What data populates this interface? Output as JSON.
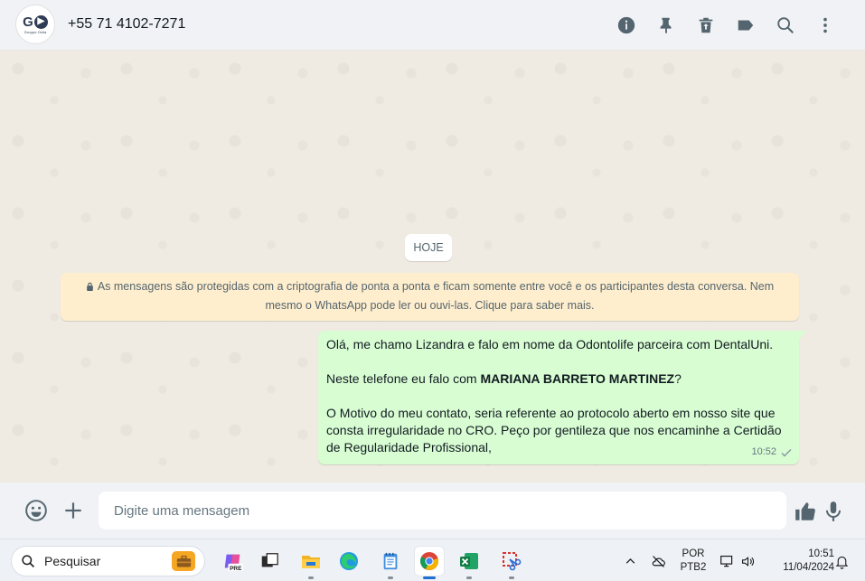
{
  "header": {
    "avatar_logo_text": "G",
    "avatar_brand": "Gruppo Ocila",
    "contact": "+55 71 4102-7271",
    "icons": [
      "info-icon",
      "pin-icon",
      "delete-icon",
      "label-icon",
      "search-icon",
      "menu-icon"
    ]
  },
  "chat": {
    "day_label": "HOJE",
    "encryption_notice": "As mensagens são protegidas com a criptografia de ponta a ponta e ficam somente entre você e os participantes desta conversa. Nem mesmo o WhatsApp pode ler ou ouvi-las. Clique para saber mais.",
    "message": {
      "line1": "Olá, me chamo Lizandra e falo em nome da Odontolife parceira com DentalUni.",
      "line2_prefix": "Neste telefone eu falo com ",
      "line2_bold": "MARIANA BARRETO MARTINEZ",
      "line2_suffix": "?",
      "line3": "O Motivo do meu contato, seria referente ao protocolo aberto em nosso site que consta irregularidade no CRO. Peço por gentileza que nos encaminhe a Certidão de Regularidade Profissional,",
      "time": "10:52",
      "status": "sent"
    }
  },
  "composer": {
    "placeholder": "Digite uma mensagem"
  },
  "taskbar": {
    "search_label": "Pesquisar",
    "apps": [
      "copilot-icon",
      "task-view-icon",
      "file-explorer-icon",
      "edge-icon",
      "notepad-icon",
      "chrome-icon",
      "excel-icon",
      "snipping-tool-icon"
    ],
    "copilot_badge": "PRE",
    "language": "POR",
    "keyboard": "PTB2",
    "time": "10:51",
    "date": "11/04/2024"
  },
  "colors": {
    "header_bg": "#f0f2f5",
    "chat_bg": "#efeae2",
    "outgoing_bubble": "#d9fdd3",
    "system_notice": "#ffeecd",
    "icon_gray": "#54656f"
  }
}
